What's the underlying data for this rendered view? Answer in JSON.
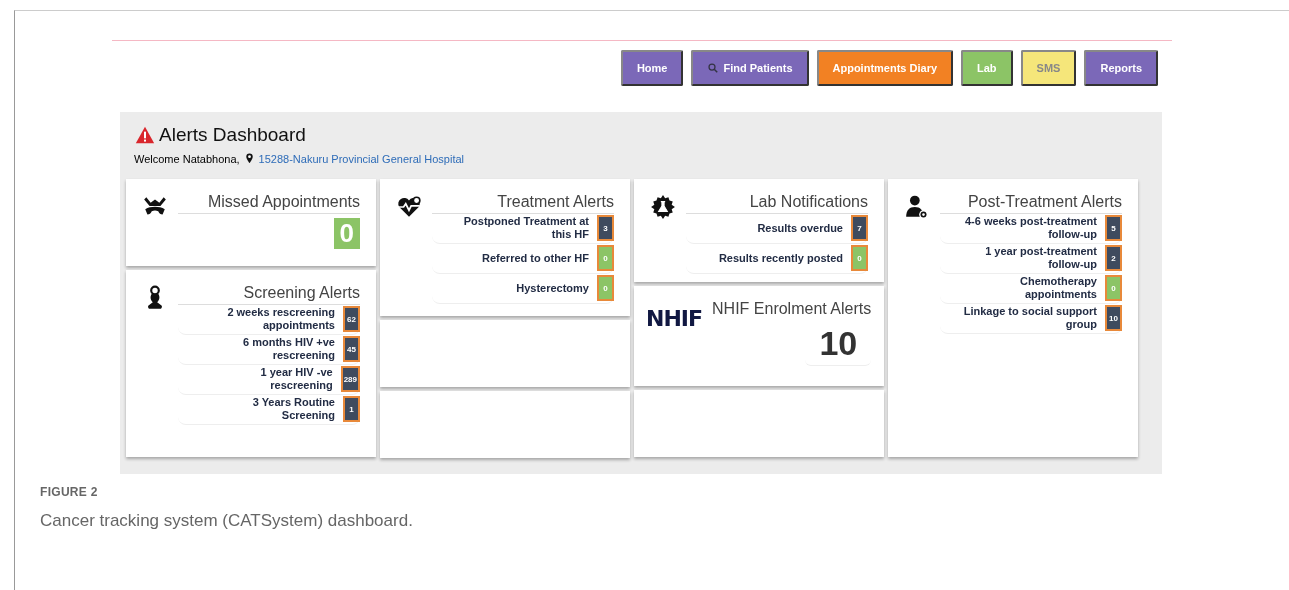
{
  "nav": [
    {
      "label": "Home",
      "color": "#7b68b8"
    },
    {
      "label": "Find Patients",
      "color": "#7b68b8",
      "icon": true
    },
    {
      "label": "Appointments Diary",
      "color": "#f28123"
    },
    {
      "label": "Lab",
      "color": "#8cc466"
    },
    {
      "label": "SMS",
      "color": "#f5e67a"
    },
    {
      "label": "Reports",
      "color": "#7b68b8"
    }
  ],
  "header": {
    "title": "Alerts Dashboard",
    "welcome": "Welcome Natabhona,",
    "facility": "15288-Nakuru Provincial General Hospital"
  },
  "columns": [
    [
      {
        "kind": "count",
        "title": "Missed Appointments",
        "value": "0",
        "color": "#8cc466"
      },
      {
        "kind": "list",
        "title": "Screening Alerts",
        "items": [
          {
            "label": "2 weeks rescreening appointments",
            "count": "62",
            "color": "#3f4b5e"
          },
          {
            "label": "6 months HIV +ve rescreening",
            "count": "45",
            "color": "#3f4b5e"
          },
          {
            "label": "1 year HIV -ve rescreening",
            "count": "289",
            "color": "#3f4b5e"
          },
          {
            "label": "3 Years Routine Screening",
            "count": "1",
            "color": "#3f4b5e"
          }
        ]
      }
    ],
    [
      {
        "kind": "list",
        "title": "Treatment Alerts",
        "items": [
          {
            "label": "Postponed Treatment at this HF",
            "count": "3",
            "color": "#3f4b5e"
          },
          {
            "label": "Referred to other HF",
            "count": "0",
            "color": "#8cc466"
          },
          {
            "label": "Hysterectomy",
            "count": "0",
            "color": "#8cc466"
          }
        ]
      },
      {
        "kind": "empty"
      },
      {
        "kind": "empty"
      }
    ],
    [
      {
        "kind": "list",
        "title": "Lab Notifications",
        "items": [
          {
            "label": "Results overdue",
            "count": "7",
            "color": "#3f4b5e"
          },
          {
            "label": "Results recently posted",
            "count": "0",
            "color": "#8cc466"
          }
        ]
      },
      {
        "kind": "logo",
        "logo": "NHIF",
        "title": "NHIF Enrolment Alerts",
        "value": "10"
      },
      {
        "kind": "empty"
      }
    ],
    [
      {
        "kind": "list",
        "title": "Post-Treatment Alerts",
        "items": [
          {
            "label": "4-6 weeks post-treatment follow-up",
            "count": "5",
            "color": "#3f4b5e"
          },
          {
            "label": "1 year post-treatment follow-up",
            "count": "2",
            "color": "#3f4b5e"
          },
          {
            "label": "Chemotherapy appointments",
            "count": "0",
            "color": "#8cc466"
          },
          {
            "label": "Linkage to social support group",
            "count": "10",
            "color": "#3f4b5e"
          }
        ]
      }
    ]
  ],
  "caption": {
    "label": "FIGURE 2",
    "text": "Cancer tracking system (CATSystem) dashboard."
  }
}
